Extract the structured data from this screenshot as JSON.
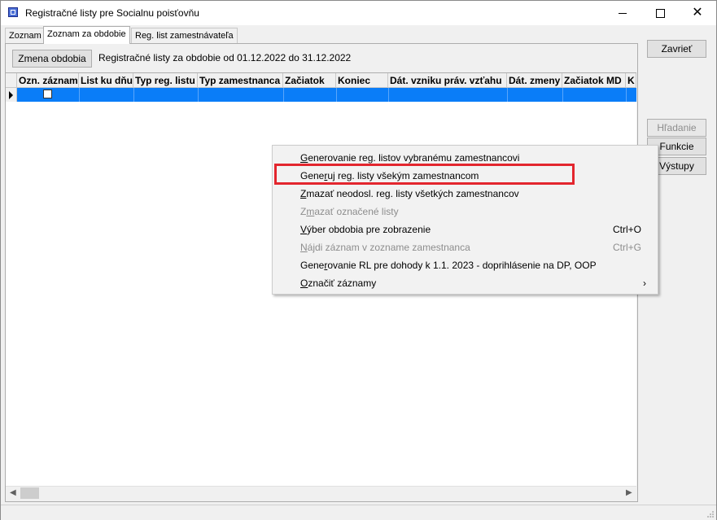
{
  "window": {
    "title": "Registračné listy pre Socialnu poisťovňu",
    "minimize_glyph": "",
    "close_glyph": "✕"
  },
  "tabs": [
    "Zoznam",
    "Zoznam za obdobie",
    "Reg. list zamestnávateľa"
  ],
  "toolbar": {
    "change_period_label": "Zmena obdobia",
    "period_text": "Registračné listy za obdobie od 01.12.2022 do 31.12.2022"
  },
  "grid": {
    "columns": [
      "Ozn. záznam",
      "List ku dňu",
      "Typ reg. listu",
      "Typ zamestnanca",
      "Začiatok",
      "Koniec",
      "Dát. vzniku práv. vzťahu",
      "Dát. zmeny",
      "Začiatok MD",
      "K"
    ],
    "rows": [
      {
        "selected": true,
        "marked": false
      }
    ]
  },
  "side_buttons": {
    "close": "Zavrieť",
    "search": "Hľadanie",
    "functions": "Funkcie",
    "outputs": "Výstupy"
  },
  "context_menu": {
    "items": [
      {
        "pre": "",
        "u": "G",
        "post": "enerovanie reg. listov vybranému zamestnancovi",
        "shortcut": "",
        "disabled": false
      },
      {
        "pre": "Gene",
        "u": "r",
        "post": "uj reg. listy všekým zamestnancom",
        "shortcut": "",
        "disabled": false
      },
      {
        "pre": "",
        "u": "Z",
        "post": "mazať neodosl. reg. listy všetkých zamestnancov",
        "shortcut": "",
        "disabled": false
      },
      {
        "pre": "Z",
        "u": "m",
        "post": "azať označené listy",
        "shortcut": "",
        "disabled": true
      },
      {
        "pre": "",
        "u": "V",
        "post": "ýber obdobia pre zobrazenie",
        "shortcut": "Ctrl+O",
        "disabled": false
      },
      {
        "pre": "",
        "u": "N",
        "post": "ájdi záznam v zozname zamestnanca",
        "shortcut": "Ctrl+G",
        "disabled": true
      },
      {
        "pre": "Gene",
        "u": "r",
        "post": "ovanie RL pre dohody k 1.1. 2023 - doprihlásenie na DP, OOP",
        "shortcut": "",
        "disabled": false
      },
      {
        "pre": "",
        "u": "O",
        "post": "značiť záznamy",
        "shortcut": "",
        "disabled": false,
        "submenu": true
      }
    ],
    "highlight_color": "#e3262e"
  },
  "colors": {
    "selection": "#0a7df8",
    "window_bg": "#f0f0f0"
  },
  "icons": {
    "submenu": "chevron-right-icon",
    "scroll_left": "arrow-left-icon",
    "scroll_right": "arrow-right-icon"
  }
}
